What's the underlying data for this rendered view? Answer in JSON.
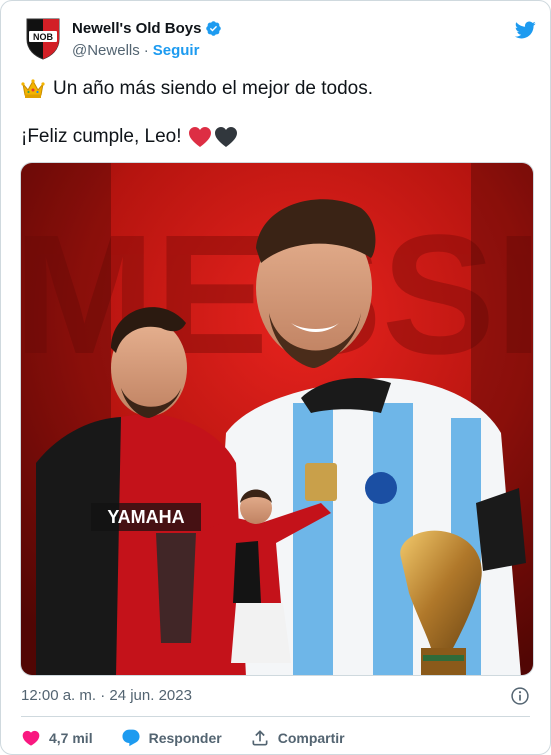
{
  "tweet": {
    "author": {
      "display_name": "Newell's Old Boys",
      "handle": "@Newells",
      "separator": "·",
      "follow_label": "Seguir",
      "avatar_text": "NOB",
      "verified": true
    },
    "text_line1": "Un año más siendo el mejor de todos.",
    "text_line2": "¡Feliz cumple, Leo!",
    "emoji_line1": "crown-icon",
    "emoji_line2": [
      "red-heart-icon",
      "black-heart-icon"
    ],
    "media": {
      "background_text": "MESSI",
      "shirt_sponsor": "YAMAHA"
    },
    "timestamp": "12:00 a. m. · 24 jun. 2023",
    "actions": {
      "likes": "4,7 mil",
      "reply_label": "Responder",
      "share_label": "Compartir"
    }
  },
  "colors": {
    "brand_blue": "#1d9bf0",
    "like_pink": "#f91880",
    "text_primary": "#0f1419",
    "text_secondary": "#536471",
    "nob_red": "#d21f26",
    "nob_black": "#111111"
  }
}
